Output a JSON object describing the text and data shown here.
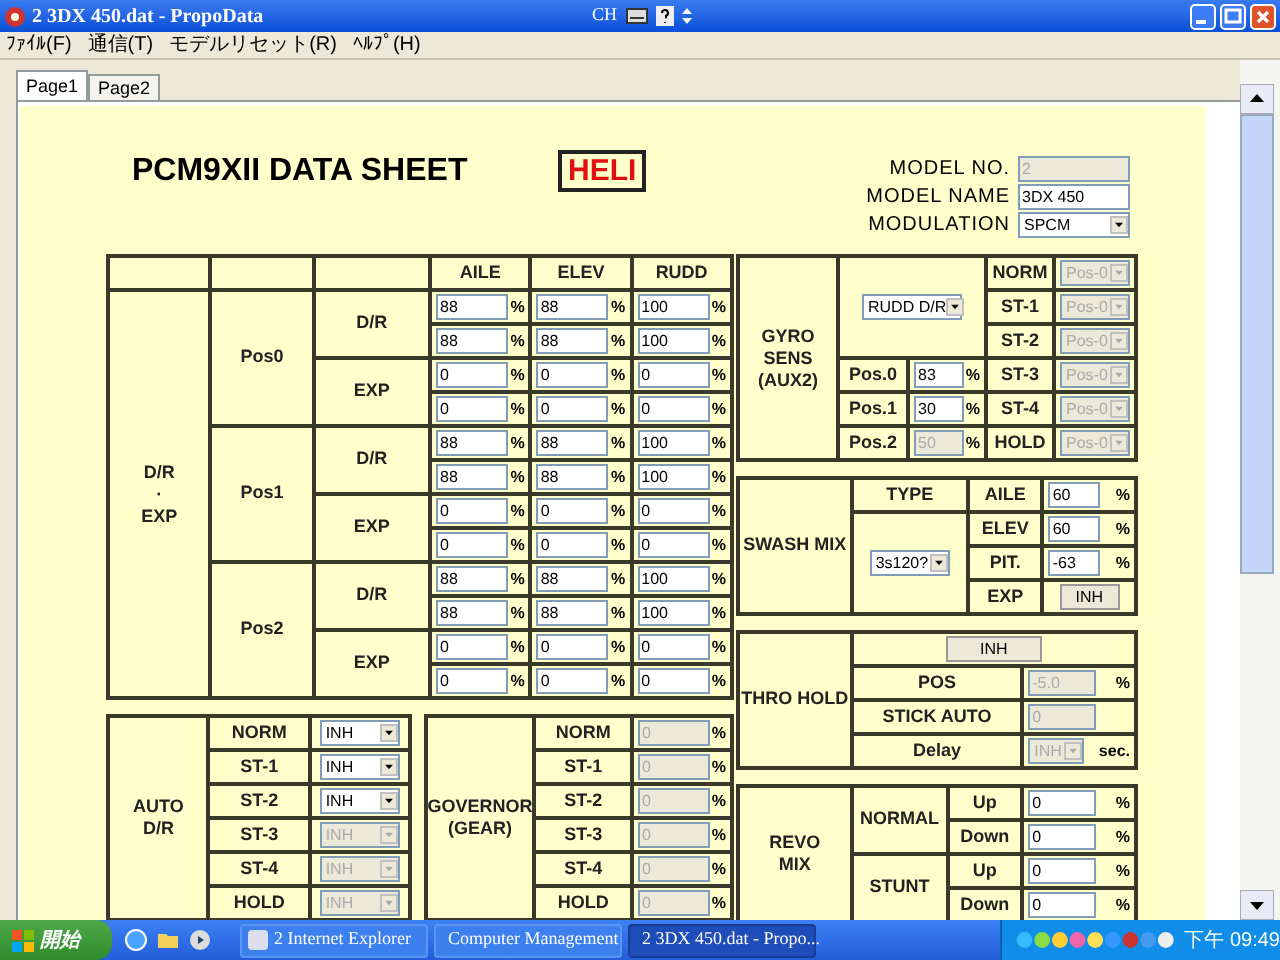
{
  "window": {
    "title": "2 3DX 450.dat - PropoData",
    "ime": "CH"
  },
  "menu": [
    "ﾌｧｲﾙ(F)",
    "通信(T)",
    "モデルリセット(R)",
    "ﾍﾙﾌﾟ(H)"
  ],
  "tabs": [
    {
      "label": "Page1",
      "selected": true
    },
    {
      "label": "Page2",
      "selected": false
    }
  ],
  "sheet": {
    "title": "PCM9XII DATA SHEET",
    "badge": "HELI"
  },
  "model": [
    {
      "label": "MODEL NO.",
      "value": "2",
      "kind": "text",
      "disabled": true
    },
    {
      "label": "MODEL NAME",
      "value": "3DX 450",
      "kind": "text",
      "disabled": false
    },
    {
      "label": "MODULATION",
      "value": "SPCM",
      "kind": "select",
      "disabled": false
    }
  ],
  "dr_exp": {
    "label": [
      "D/R",
      "·",
      "EXP"
    ],
    "columns": [
      "AILE",
      "ELEV",
      "RUDD"
    ],
    "positions": [
      {
        "name": "Pos0",
        "groups": [
          {
            "name": "D/R",
            "rows": [
              [
                {
                  "value": "88",
                  "unit": "%"
                },
                {
                  "value": "88",
                  "unit": "%"
                },
                {
                  "value": "100",
                  "unit": "%"
                }
              ],
              [
                {
                  "value": "88",
                  "unit": "%"
                },
                {
                  "value": "88",
                  "unit": "%"
                },
                {
                  "value": "100",
                  "unit": "%"
                }
              ]
            ]
          },
          {
            "name": "EXP",
            "rows": [
              [
                {
                  "value": "0",
                  "unit": "%"
                },
                {
                  "value": "0",
                  "unit": "%"
                },
                {
                  "value": "0",
                  "unit": "%"
                }
              ],
              [
                {
                  "value": "0",
                  "unit": "%"
                },
                {
                  "value": "0",
                  "unit": "%"
                },
                {
                  "value": "0",
                  "unit": "%"
                }
              ]
            ]
          }
        ]
      },
      {
        "name": "Pos1",
        "groups": [
          {
            "name": "D/R",
            "rows": [
              [
                {
                  "value": "88",
                  "unit": "%"
                },
                {
                  "value": "88",
                  "unit": "%"
                },
                {
                  "value": "100",
                  "unit": "%"
                }
              ],
              [
                {
                  "value": "88",
                  "unit": "%"
                },
                {
                  "value": "88",
                  "unit": "%"
                },
                {
                  "value": "100",
                  "unit": "%"
                }
              ]
            ]
          },
          {
            "name": "EXP",
            "rows": [
              [
                {
                  "value": "0",
                  "unit": "%"
                },
                {
                  "value": "0",
                  "unit": "%"
                },
                {
                  "value": "0",
                  "unit": "%"
                }
              ],
              [
                {
                  "value": "0",
                  "unit": "%"
                },
                {
                  "value": "0",
                  "unit": "%"
                },
                {
                  "value": "0",
                  "unit": "%"
                }
              ]
            ]
          }
        ]
      },
      {
        "name": "Pos2",
        "groups": [
          {
            "name": "D/R",
            "rows": [
              [
                {
                  "value": "88",
                  "unit": "%"
                },
                {
                  "value": "88",
                  "unit": "%"
                },
                {
                  "value": "100",
                  "unit": "%"
                }
              ],
              [
                {
                  "value": "88",
                  "unit": "%"
                },
                {
                  "value": "88",
                  "unit": "%"
                },
                {
                  "value": "100",
                  "unit": "%"
                }
              ]
            ]
          },
          {
            "name": "EXP",
            "rows": [
              [
                {
                  "value": "0",
                  "unit": "%"
                },
                {
                  "value": "0",
                  "unit": "%"
                },
                {
                  "value": "0",
                  "unit": "%"
                }
              ],
              [
                {
                  "value": "0",
                  "unit": "%"
                },
                {
                  "value": "0",
                  "unit": "%"
                },
                {
                  "value": "0",
                  "unit": "%"
                }
              ]
            ]
          }
        ]
      }
    ]
  },
  "auto_dr": {
    "label": [
      "AUTO",
      "D/R"
    ],
    "rows": [
      {
        "label": "NORM",
        "value": "INH",
        "disabled": false
      },
      {
        "label": "ST-1",
        "value": "INH",
        "disabled": false
      },
      {
        "label": "ST-2",
        "value": "INH",
        "disabled": false
      },
      {
        "label": "ST-3",
        "value": "INH",
        "disabled": true
      },
      {
        "label": "ST-4",
        "value": "INH",
        "disabled": true
      },
      {
        "label": "HOLD",
        "value": "INH",
        "disabled": true
      }
    ]
  },
  "governor": {
    "label": [
      "GOVERNOR",
      "(GEAR)"
    ],
    "rows": [
      {
        "label": "NORM",
        "value": "0",
        "unit": "%",
        "disabled": true
      },
      {
        "label": "ST-1",
        "value": "0",
        "unit": "%",
        "disabled": true
      },
      {
        "label": "ST-2",
        "value": "0",
        "unit": "%",
        "disabled": true
      },
      {
        "label": "ST-3",
        "value": "0",
        "unit": "%",
        "disabled": true
      },
      {
        "label": "ST-4",
        "value": "0",
        "unit": "%",
        "disabled": true
      },
      {
        "label": "HOLD",
        "value": "0",
        "unit": "%",
        "disabled": true
      }
    ]
  },
  "gyro": {
    "label": [
      "GYRO SENS",
      "(AUX2)"
    ],
    "switch": {
      "value": "RUDD D/R",
      "disabled": false
    },
    "positions": [
      {
        "label": "Pos.0",
        "value": "83",
        "unit": "%",
        "disabled": false
      },
      {
        "label": "Pos.1",
        "value": "30",
        "unit": "%",
        "disabled": false
      },
      {
        "label": "Pos.2",
        "value": "50",
        "unit": "%",
        "disabled": true
      }
    ],
    "conditions": [
      {
        "label": "NORM",
        "value": "Pos-0",
        "disabled": true
      },
      {
        "label": "ST-1",
        "value": "Pos-0",
        "disabled": true
      },
      {
        "label": "ST-2",
        "value": "Pos-0",
        "disabled": true
      },
      {
        "label": "ST-3",
        "value": "Pos-0",
        "disabled": true
      },
      {
        "label": "ST-4",
        "value": "Pos-0",
        "disabled": true
      },
      {
        "label": "HOLD",
        "value": "Pos-0",
        "disabled": true
      }
    ]
  },
  "swash": {
    "label": "SWASH MIX",
    "type_label": "TYPE",
    "type": "3s120?",
    "rates": [
      {
        "label": "AILE",
        "value": "60",
        "unit": "%"
      },
      {
        "label": "ELEV",
        "value": "60",
        "unit": "%"
      },
      {
        "label": "PIT.",
        "value": "-63",
        "unit": "%"
      }
    ],
    "exp_label": "EXP",
    "exp_button": "INH"
  },
  "thro_hold": {
    "label": "THRO HOLD",
    "button": "INH",
    "rows": [
      {
        "label": "POS",
        "value": "-5.0",
        "unit": "%",
        "kind": "input",
        "disabled": true
      },
      {
        "label": "STICK AUTO",
        "value": "0",
        "kind": "input",
        "disabled": true
      },
      {
        "label": "Delay",
        "value": "INH",
        "unit": "sec.",
        "kind": "select",
        "disabled": true
      }
    ]
  },
  "revo": {
    "label": [
      "REVO",
      "MIX"
    ],
    "groups": [
      {
        "name": "NORMAL",
        "rows": [
          {
            "label": "Up",
            "value": "0",
            "unit": "%"
          },
          {
            "label": "Down",
            "value": "0",
            "unit": "%"
          }
        ]
      },
      {
        "name": "STUNT",
        "rows": [
          {
            "label": "Up",
            "value": "0",
            "unit": "%"
          },
          {
            "label": "Down",
            "value": "0",
            "unit": "%"
          }
        ]
      }
    ]
  },
  "taskbar": {
    "start": "開始",
    "tasks": [
      {
        "label": "2 Internet Explorer",
        "selected": false
      },
      {
        "label": "Computer Management",
        "selected": false
      },
      {
        "label": "2 3DX 450.dat - Propo...",
        "selected": true
      }
    ],
    "clock": "下午 09:49"
  }
}
